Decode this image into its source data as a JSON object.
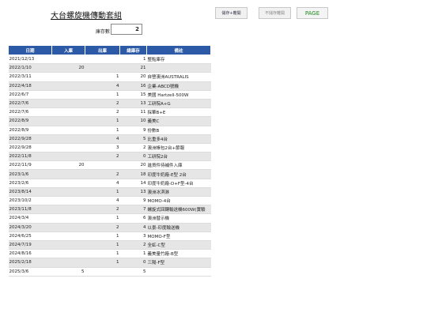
{
  "title": "大台螺旋機傳動套組",
  "buttons": {
    "b1": "儲存+離開",
    "b2": "不儲存離開",
    "b3": "PAGE"
  },
  "stock": {
    "label": "庫存數",
    "value": "2"
  },
  "table": {
    "headers": [
      "日期",
      "入庫",
      "出庫",
      "總庫存",
      "備註"
    ],
    "rows": [
      {
        "date": "2021/12/13",
        "in": "",
        "out": "",
        "total": "1",
        "note": "整點庫存"
      },
      {
        "date": "2022/1/10",
        "in": "20",
        "out": "",
        "total": "21",
        "note": ""
      },
      {
        "date": "2022/3/11",
        "in": "",
        "out": "1",
        "total": "20",
        "note": "自營澳洲AUSTRALIS"
      },
      {
        "date": "2022/4/18",
        "in": "",
        "out": "4",
        "total": "16",
        "note": "企業-ABCD號機"
      },
      {
        "date": "2022/6/7",
        "in": "",
        "out": "1",
        "total": "15",
        "note": "美國 Hartzell-500W"
      },
      {
        "date": "2022/7/6",
        "in": "",
        "out": "2",
        "total": "13",
        "note": "工研院A+G"
      },
      {
        "date": "2022/7/6",
        "in": "",
        "out": "2",
        "total": "11",
        "note": "採華B+E"
      },
      {
        "date": "2022/8/9",
        "in": "",
        "out": "1",
        "total": "10",
        "note": "義美C"
      },
      {
        "date": "2022/8/9",
        "in": "",
        "out": "1",
        "total": "9",
        "note": "份數B"
      },
      {
        "date": "2022/9/28",
        "in": "",
        "out": "4",
        "total": "5",
        "note": "比重多4台"
      },
      {
        "date": "2022/9/28",
        "in": "",
        "out": "3",
        "total": "2",
        "note": "澳洲帳包2台+節報"
      },
      {
        "date": "2022/11/8",
        "in": "",
        "out": "2",
        "total": "0",
        "note": "工研院2台"
      },
      {
        "date": "2022/11/9",
        "in": "20",
        "out": "",
        "total": "20",
        "note": "進貨件待補件入庫"
      },
      {
        "date": "2023/1/6",
        "in": "",
        "out": "2",
        "total": "18",
        "note": "印度牛奶廠-E型 2台"
      },
      {
        "date": "2023/2/6",
        "in": "",
        "out": "4",
        "total": "14",
        "note": "印度牛奶廠-D+F型-4台"
      },
      {
        "date": "2023/8/14",
        "in": "",
        "out": "1",
        "total": "13",
        "note": "澳洲冰淇淋"
      },
      {
        "date": "2023/10/2",
        "in": "",
        "out": "4",
        "total": "9",
        "note": "MOMO-4台"
      },
      {
        "date": "2023/11/8",
        "in": "",
        "out": "2",
        "total": "7",
        "note": "螺旋式回轉輸送機600W(實驗"
      },
      {
        "date": "2024/3/4",
        "in": "",
        "out": "1",
        "total": "6",
        "note": "澳洲替示機"
      },
      {
        "date": "2024/3/20",
        "in": "",
        "out": "2",
        "total": "4",
        "note": "以景-印度輸送機"
      },
      {
        "date": "2024/6/25",
        "in": "",
        "out": "1",
        "total": "3",
        "note": "MOMO-F型"
      },
      {
        "date": "2024/7/19",
        "in": "",
        "out": "1",
        "total": "2",
        "note": "全虹-C型"
      },
      {
        "date": "2024/8/16",
        "in": "",
        "out": "1",
        "total": "1",
        "note": "義美量竹廠-B型"
      },
      {
        "date": "2025/2/18",
        "in": "",
        "out": "1",
        "total": "0",
        "note": "三陽-F型"
      },
      {
        "date": "2025/3/6",
        "in": "5",
        "out": "",
        "total": "5",
        "note": ""
      }
    ]
  }
}
